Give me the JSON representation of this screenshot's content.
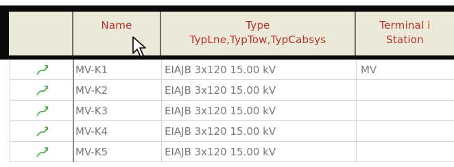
{
  "table": {
    "columns": [
      {
        "lines": [
          ""
        ]
      },
      {
        "lines": [
          "Name"
        ]
      },
      {
        "lines": [
          "Type",
          "TypLne,TypTow,TypCabsys"
        ]
      },
      {
        "lines": [
          "Terminal i",
          "Station"
        ]
      }
    ],
    "rows": [
      {
        "icon": "line-route-icon",
        "name": "MV-K1",
        "type": "EIAJB 3x120  15.00 kV",
        "terminal": "MV"
      },
      {
        "icon": "line-route-icon",
        "name": "MV-K2",
        "type": "EIAJB 3x120  15.00 kV",
        "terminal": ""
      },
      {
        "icon": "line-route-icon",
        "name": "MV-K3",
        "type": "EIAJB 3x120  15.00 kV",
        "terminal": ""
      },
      {
        "icon": "line-route-icon",
        "name": "MV-K4",
        "type": "EIAJB 3x120  15.00 kV",
        "terminal": ""
      },
      {
        "icon": "line-route-icon",
        "name": "MV-K5",
        "type": "EIAJB 3x120  15.00 kV",
        "terminal": ""
      }
    ]
  },
  "colors": {
    "header_text": "#b3312b",
    "header_bg": "#ece9d8",
    "cell_text": "#7a7a7a",
    "icon_green": "#3aa63a"
  },
  "cursor": "arrow-pointer-icon"
}
